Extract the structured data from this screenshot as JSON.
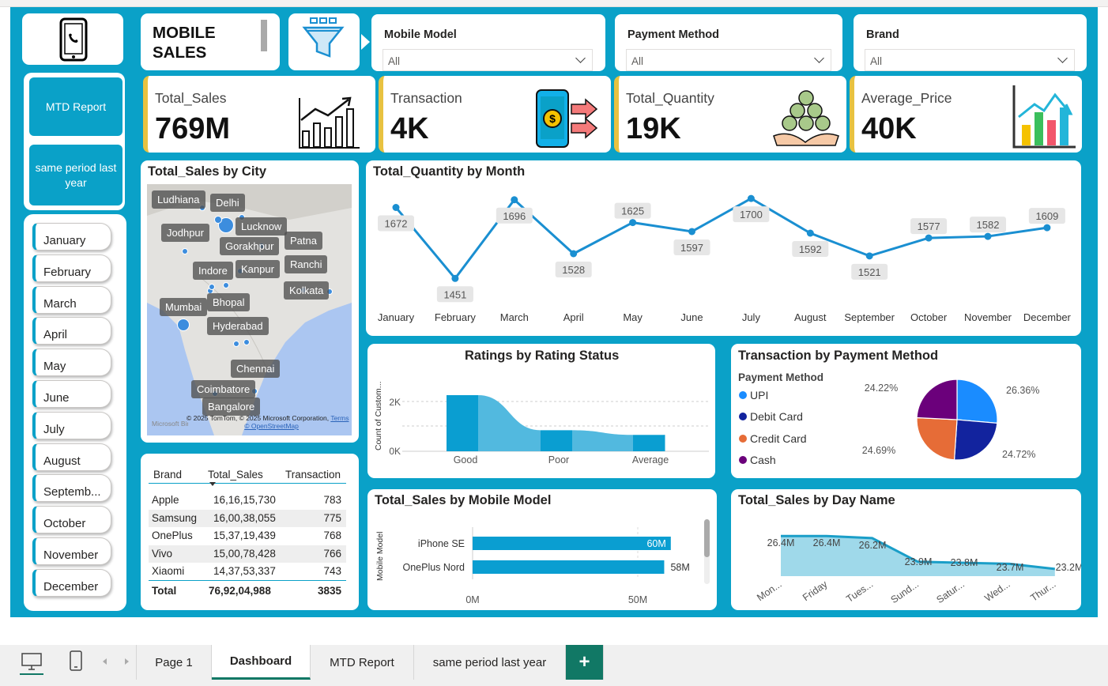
{
  "title": {
    "line1": "MOBILE",
    "line2": "SALES"
  },
  "nav": {
    "mtd": "MTD Report",
    "spl": "same period last year"
  },
  "months": [
    "January",
    "February",
    "March",
    "April",
    "May",
    "June",
    "July",
    "August",
    "Septemb...",
    "October",
    "November",
    "December"
  ],
  "slicers": [
    {
      "label": "Mobile Model",
      "value": "All"
    },
    {
      "label": "Payment Method",
      "value": "All"
    },
    {
      "label": "Brand",
      "value": "All"
    }
  ],
  "kpis": [
    {
      "label": "Total_Sales",
      "value": "769M"
    },
    {
      "label": "Transaction",
      "value": "4K"
    },
    {
      "label": "Total_Quantity",
      "value": "19K"
    },
    {
      "label": "Average_Price",
      "value": "40K"
    }
  ],
  "map": {
    "title": "Total_Sales by City",
    "cities": [
      "Ludhiana",
      "Delhi",
      "Jodhpur",
      "Lucknow",
      "Patna",
      "Gorakhpur",
      "Ranchi",
      "Indore",
      "Kanpur",
      "Kolkata",
      "Bhopal",
      "Mumbai",
      "Hyderabad",
      "Chennai",
      "Coimbatore",
      "Bangalore"
    ],
    "attrib": "© 2025 TomTom, © 2025 Microsoft Corporation,",
    "terms": "Terms",
    "osm": "© OpenStreetMap",
    "ms": "Microsoft Bing"
  },
  "brand_table": {
    "headers": [
      "Brand",
      "Total_Sales",
      "Transaction"
    ],
    "rows": [
      [
        "Apple",
        "16,16,15,730",
        "783"
      ],
      [
        "Samsung",
        "16,00,38,055",
        "775"
      ],
      [
        "OnePlus",
        "15,37,19,439",
        "768"
      ],
      [
        "Vivo",
        "15,00,78,428",
        "766"
      ],
      [
        "Xiaomi",
        "14,37,53,337",
        "743"
      ]
    ],
    "total": [
      "Total",
      "76,92,04,988",
      "3835"
    ]
  },
  "qty_chart": {
    "title": "Total_Quantity by Month"
  },
  "ratings_chart": {
    "title": "Ratings by Rating Status",
    "ylabel": "Count of Custom...",
    "yticks": [
      "2K",
      "0K"
    ]
  },
  "payment_chart": {
    "title": "Transaction by Payment Method",
    "legend_title": "Payment Method"
  },
  "model_chart": {
    "title": "Total_Sales by Mobile Model",
    "ylabel": "Mobile Model",
    "xticks": [
      "0M",
      "50M"
    ],
    "labels": [
      "60M",
      "58M"
    ]
  },
  "day_chart": {
    "title": "Total_Sales by Day Name"
  },
  "tabs": [
    "Page 1",
    "Dashboard",
    "MTD Report",
    "same period last year"
  ],
  "tab_add": "+",
  "colors": {
    "accent": "#0aa1c8",
    "kpi_bar": "#e8c240",
    "line": "#1a8fd1",
    "tab_active": "#117865",
    "upi": "#1a8cff",
    "debit": "#12239e",
    "credit": "#e66c37",
    "cash": "#6b007b"
  },
  "chart_data": [
    {
      "type": "line",
      "title": "Total_Quantity by Month",
      "categories": [
        "January",
        "February",
        "March",
        "April",
        "May",
        "June",
        "July",
        "August",
        "September",
        "October",
        "November",
        "December"
      ],
      "values": [
        1672,
        1451,
        1696,
        1528,
        1625,
        1597,
        1700,
        1592,
        1521,
        1577,
        1582,
        1609
      ]
    },
    {
      "type": "area",
      "title": "Ratings by Rating Status",
      "categories": [
        "Good",
        "Poor",
        "Average"
      ],
      "values": [
        2400,
        900,
        700
      ],
      "ylabel": "Count of Custom...",
      "yticks": [
        "2K",
        "0K"
      ]
    },
    {
      "type": "pie",
      "title": "Transaction by Payment Method",
      "categories": [
        "UPI",
        "Debit Card",
        "Credit Card",
        "Cash"
      ],
      "values": [
        26.36,
        24.72,
        24.69,
        24.22
      ],
      "labels": [
        "26.36%",
        "24.72%",
        "24.69%",
        "24.22%"
      ]
    },
    {
      "type": "bar",
      "title": "Total_Sales by Mobile Model",
      "categories": [
        "iPhone SE",
        "OnePlus Nord"
      ],
      "values": [
        60,
        58
      ],
      "ylabel": "Mobile Model"
    },
    {
      "type": "area",
      "title": "Total_Sales by Day Name",
      "categories": [
        "Mon...",
        "Friday",
        "Tues...",
        "Sund...",
        "Satur...",
        "Wed...",
        "Thur..."
      ],
      "values": [
        26.4,
        26.4,
        26.2,
        23.9,
        23.8,
        23.7,
        23.2
      ],
      "labels": [
        "26.4M",
        "26.4M",
        "26.2M",
        "23.9M",
        "23.8M",
        "23.7M",
        "23.2M"
      ]
    }
  ]
}
